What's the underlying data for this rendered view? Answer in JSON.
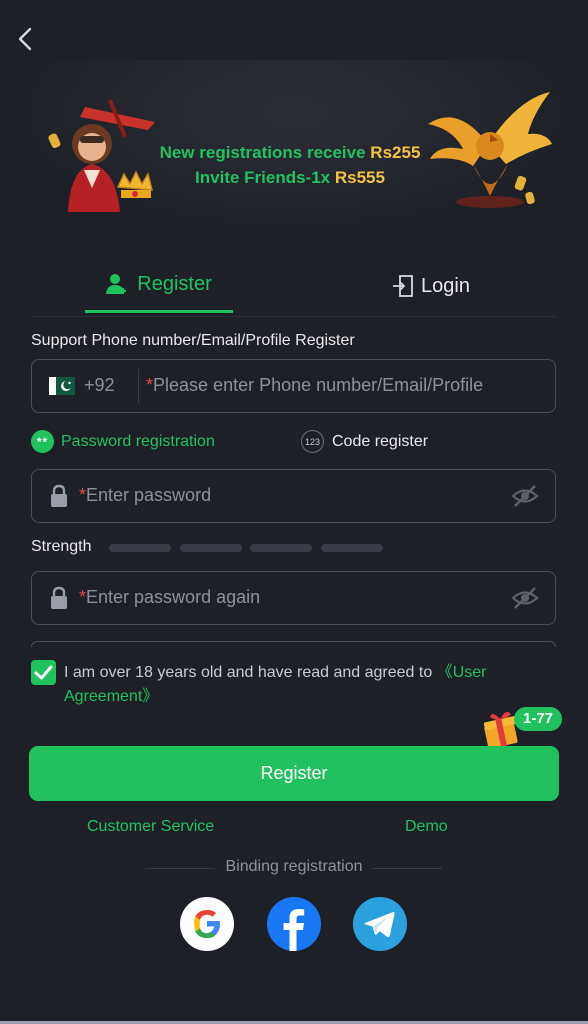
{
  "banner": {
    "line1_text": "New registrations receive ",
    "line1_amount": "Rs255",
    "line2_text": "Invite Friends-1x ",
    "line2_amount": "Rs555"
  },
  "tabs": {
    "register": "Register",
    "login": "Login"
  },
  "form": {
    "support_label": "Support Phone number/Email/Profile Register",
    "country_code": "+92",
    "phone_placeholder": "Please enter Phone number/Email/Profile",
    "mode_password": "Password registration",
    "mode_code": "Code register",
    "mode_password_icon_text": "**",
    "mode_code_icon_text": "123",
    "password_placeholder": "Enter password",
    "strength_label": "Strength",
    "password_again_placeholder": "Enter password again",
    "required_mark": "*"
  },
  "agreement": {
    "checked": true,
    "text": "I am over 18 years old and have read and agreed to ",
    "link": "《User Agreement》"
  },
  "gift_badge": "1-77",
  "register_button": "Register",
  "links": {
    "customer_service": "Customer Service",
    "demo": "Demo"
  },
  "binding": {
    "label": "Binding registration",
    "providers": [
      "google-icon",
      "facebook-icon",
      "telegram-icon"
    ]
  },
  "colors": {
    "accent": "#21c25e",
    "gold": "#f6c443",
    "background": "#1e2027"
  }
}
